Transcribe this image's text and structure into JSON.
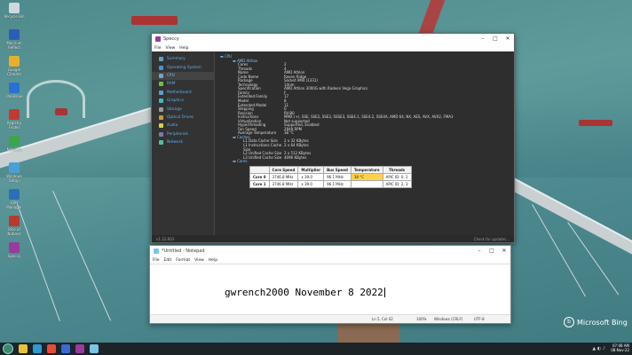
{
  "desktop": {
    "icons": [
      {
        "label": "Recycle Bin",
        "color": "#cfd8dc"
      },
      {
        "label": "Macrium Reflect",
        "color": "#2b5db8"
      },
      {
        "label": "Google Chrome",
        "color": "#e8b02a"
      },
      {
        "label": "OneDrive",
        "color": "#2a6fd6"
      },
      {
        "label": "Registry Finder",
        "color": "#c23a2f"
      },
      {
        "label": "Network",
        "color": "#3aa64a"
      },
      {
        "label": "Windows Setup",
        "color": "#4aa0d6"
      },
      {
        "label": "IDM Manager",
        "color": "#2a6fb8"
      },
      {
        "label": "Rise of Nations",
        "color": "#b83a2f"
      },
      {
        "label": "Speccy",
        "color": "#9a3aa0"
      }
    ],
    "watermark": "Microsoft Bing"
  },
  "speccy": {
    "title": "Speccy",
    "menu": [
      "File",
      "View",
      "Help"
    ],
    "sidebar": [
      {
        "label": "Summary",
        "color": "#5a9fd4"
      },
      {
        "label": "Operating System",
        "color": "#4a8fd4"
      },
      {
        "label": "CPU",
        "color": "#7aa0c4"
      },
      {
        "label": "RAM",
        "color": "#6fbf4a"
      },
      {
        "label": "Motherboard",
        "color": "#5a9fd4"
      },
      {
        "label": "Graphics",
        "color": "#4ab0c4"
      },
      {
        "label": "Storage",
        "color": "#9a9a9a"
      },
      {
        "label": "Optical Drives",
        "color": "#c89a3a"
      },
      {
        "label": "Audio",
        "color": "#d4d44a"
      },
      {
        "label": "Peripherals",
        "color": "#7a7aaa"
      },
      {
        "label": "Network",
        "color": "#4ac4a0"
      }
    ],
    "section_title": "CPU",
    "cpu_name": "AMD Athlon",
    "specs": [
      {
        "k": "Cores",
        "v": "2"
      },
      {
        "k": "Threads",
        "v": "4"
      },
      {
        "k": "Name",
        "v": "AMD Athlon"
      },
      {
        "k": "Code Name",
        "v": "Raven Ridge"
      },
      {
        "k": "Package",
        "v": "Socket AM4 (1331)"
      },
      {
        "k": "Technology",
        "v": "14nm"
      },
      {
        "k": "Specification",
        "v": "AMD Athlon 3000G with Radeon Vega Graphics"
      },
      {
        "k": "Family",
        "v": "F"
      },
      {
        "k": "Extended Family",
        "v": "17"
      },
      {
        "k": "Model",
        "v": "8"
      },
      {
        "k": "Extended Model",
        "v": "11"
      },
      {
        "k": "Stepping",
        "v": "0"
      },
      {
        "k": "Revision",
        "v": "RV-B0"
      },
      {
        "k": "Instructions",
        "v": "MMX (+), SSE, SSE2, SSE3, SSSE3, SSE4.1, SSE4.2, SSE4A, AMD 64, NX, AES, AVX, AVX2, FMA3"
      },
      {
        "k": "Virtualization",
        "v": "Not supported"
      },
      {
        "k": "Hyperthreading",
        "v": "Supported, Enabled"
      },
      {
        "k": "Fan Speed",
        "v": "2848 RPM"
      },
      {
        "k": "Average Temperature",
        "v": "38 °C"
      }
    ],
    "caches_title": "Caches",
    "caches": [
      {
        "k": "L1 Data Cache Size",
        "v": "2 x 32 KBytes"
      },
      {
        "k": "L1 Instructions Cache Size",
        "v": "2 x 64 KBytes"
      },
      {
        "k": "L2 Unified Cache Size",
        "v": "2 x 512 KBytes"
      },
      {
        "k": "L3 Unified Cache Size",
        "v": "4096 KBytes"
      }
    ],
    "cores_title": "Cores",
    "core_table": {
      "headers": [
        "",
        "Core Speed",
        "Multiplier",
        "Bus Speed",
        "Temperature",
        "Threads"
      ],
      "rows": [
        [
          "Core 0",
          "3746.8 MHz",
          "x 39.0",
          "96.1 MHz",
          "38 °C",
          "APIC ID: 0, 1"
        ],
        [
          "Core 1",
          "3746.8 MHz",
          "x 39.0",
          "96.1 MHz",
          "",
          "APIC ID: 2, 3"
        ]
      ]
    },
    "version": "v1.32.803",
    "update_text": "Check for updates..."
  },
  "notepad": {
    "title": "*Untitled - Notepad",
    "menu": [
      "File",
      "Edit",
      "Format",
      "View",
      "Help"
    ],
    "text": "gwrench2000 November 8 2022",
    "status": {
      "position": "Ln 5, Col 42",
      "zoom": "100%",
      "eol": "Windows (CRLF)",
      "encoding": "UTF-8"
    }
  },
  "taskbar": {
    "apps": [
      {
        "name": "file-explorer",
        "color": "#e8c23a"
      },
      {
        "name": "edge",
        "color": "#2a9ad6"
      },
      {
        "name": "chrome",
        "color": "#e84a3a"
      },
      {
        "name": "mail",
        "color": "#3a6ad6"
      },
      {
        "name": "speccy",
        "color": "#9a3aa0"
      },
      {
        "name": "notepad",
        "color": "#7ac4e8"
      }
    ],
    "time": "07:08 AM",
    "date": "08-Nov-22"
  }
}
